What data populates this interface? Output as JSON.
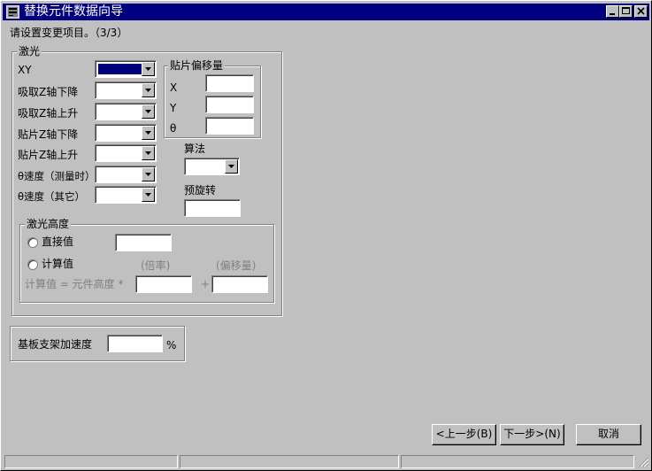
{
  "window": {
    "title": "替换元件数据向导",
    "controls": {
      "minimize": "minimize",
      "maximize": "maximize",
      "close": "close"
    }
  },
  "instruction": "请设置变更项目。（3/3）",
  "laser_group": {
    "caption": "激光",
    "rows": [
      {
        "label": "XY"
      },
      {
        "label": "吸取Z轴下降"
      },
      {
        "label": "吸取Z轴上升"
      },
      {
        "label": "贴片Z轴下降"
      },
      {
        "label": "贴片Z轴上升"
      },
      {
        "label": "θ速度（测量时）"
      },
      {
        "label": "θ速度（其它）"
      }
    ]
  },
  "offset_group": {
    "caption": "贴片偏移量",
    "x_label": "X",
    "y_label": "Y",
    "theta_label": "θ"
  },
  "algorithm_label": "算法",
  "prerotate_label": "预旋转",
  "height_group": {
    "caption": "激光高度",
    "direct_label": "直接值",
    "calc_label": "计算值",
    "ratio_label": "(倍率)",
    "offset_label": "(偏移量)",
    "formula_label": "计算值 = 元件高度 *",
    "plus": "+"
  },
  "accel": {
    "label": "基板支架加速度",
    "unit": "%"
  },
  "buttons": {
    "back": "<上一步(B)",
    "next": "下一步>(N)",
    "cancel": "取消"
  }
}
